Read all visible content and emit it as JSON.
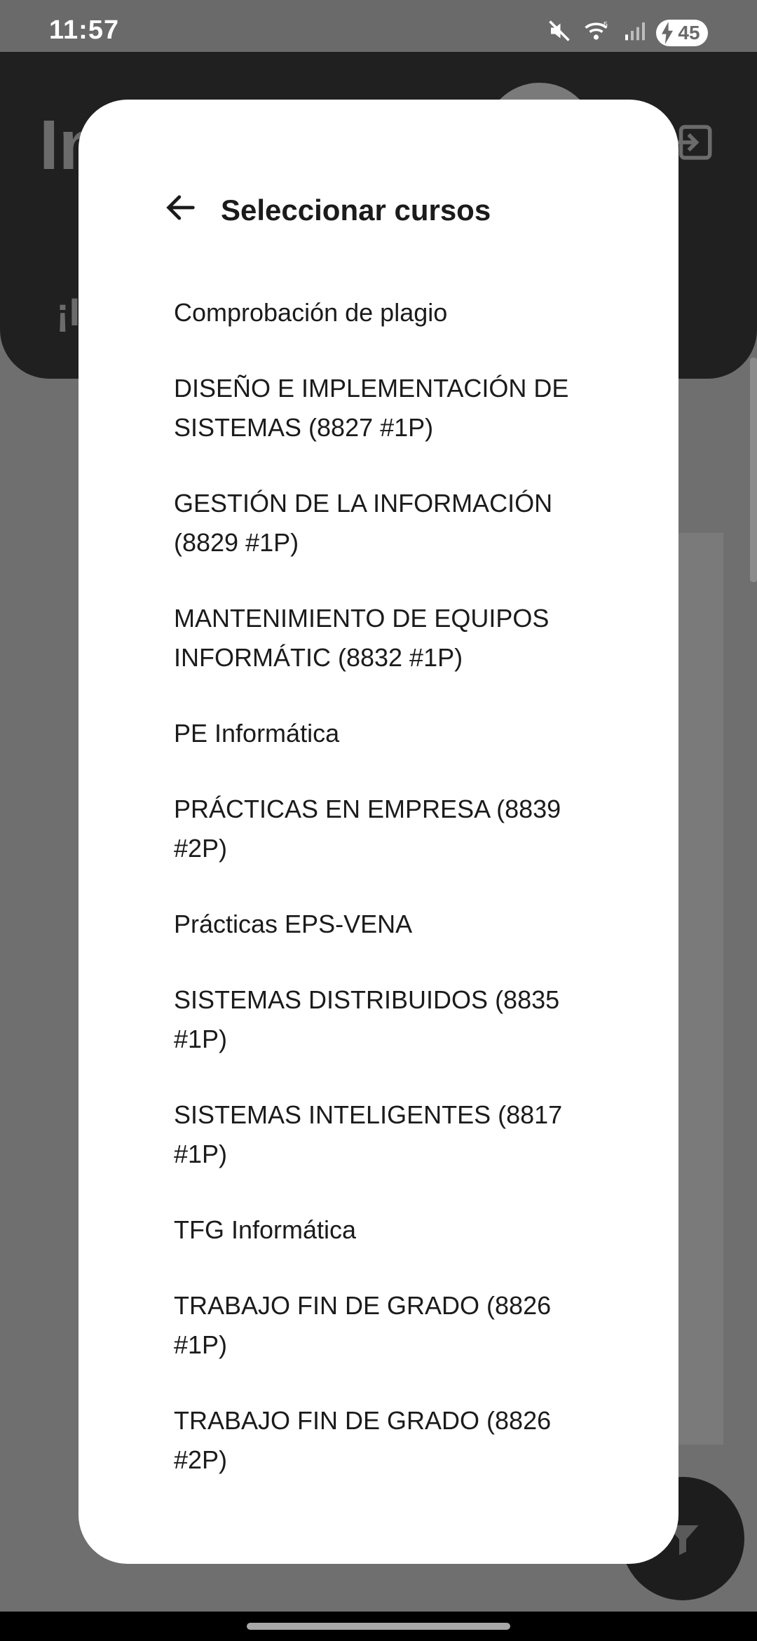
{
  "status_bar": {
    "time": "11:57",
    "battery": "45",
    "icons": [
      "mute-icon",
      "wifi-icon",
      "signal-icon",
      "battery-charging-icon"
    ]
  },
  "background_app": {
    "title_peek": "In",
    "subtitle_peek": "¡I",
    "icons": [
      "logout-icon",
      "filter-icon"
    ]
  },
  "dialog": {
    "title": "Seleccionar cursos",
    "back_icon": "arrow-left-icon",
    "courses": [
      "Comprobación de plagio",
      "DISEÑO E IMPLEMENTACIÓN DE SISTEMAS (8827 #1P)",
      "GESTIÓN DE LA INFORMACIÓN (8829 #1P)",
      "MANTENIMIENTO DE EQUIPOS INFORMÁTIC (8832 #1P)",
      "PE Informática",
      "PRÁCTICAS EN EMPRESA (8839 #2P)",
      "Prácticas EPS-VENA",
      "SISTEMAS DISTRIBUIDOS (8835 #1P)",
      "SISTEMAS INTELIGENTES (8817 #1P)",
      "TFG Informática",
      "TRABAJO FIN DE GRADO (8826 #1P)",
      "TRABAJO FIN DE GRADO (8826 #2P)"
    ]
  }
}
